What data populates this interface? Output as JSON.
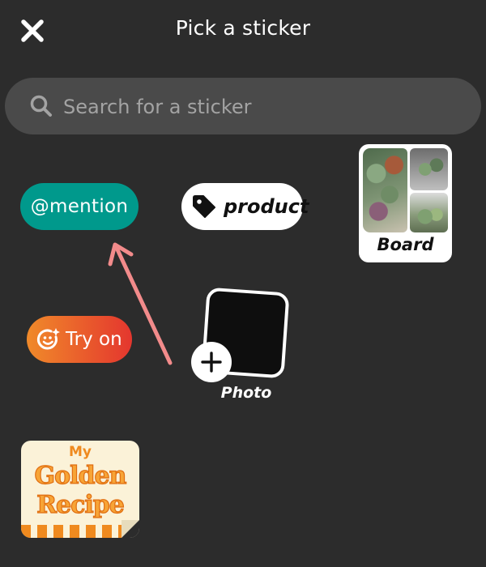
{
  "header": {
    "title": "Pick a sticker"
  },
  "search": {
    "placeholder": "Search for a sticker"
  },
  "stickers": {
    "mention": "@mention",
    "product": "product",
    "board": "Board",
    "try_on": "Try on",
    "photo": "Photo",
    "recipe": {
      "line1": "My",
      "line2": "Golden",
      "line3": "Recipe"
    }
  },
  "colors": {
    "background": "#2c2c2c",
    "search_bg": "#4a4a4a",
    "mention_bg": "#00998c",
    "try_on_gradient_start": "#f08a2a",
    "try_on_gradient_end": "#e4362e",
    "arrow": "#f28b8b",
    "recipe_orange": "#ef8a1f"
  },
  "icons": [
    "close-icon",
    "search-icon",
    "tag-icon",
    "face-sparkle-icon",
    "plus-icon"
  ]
}
